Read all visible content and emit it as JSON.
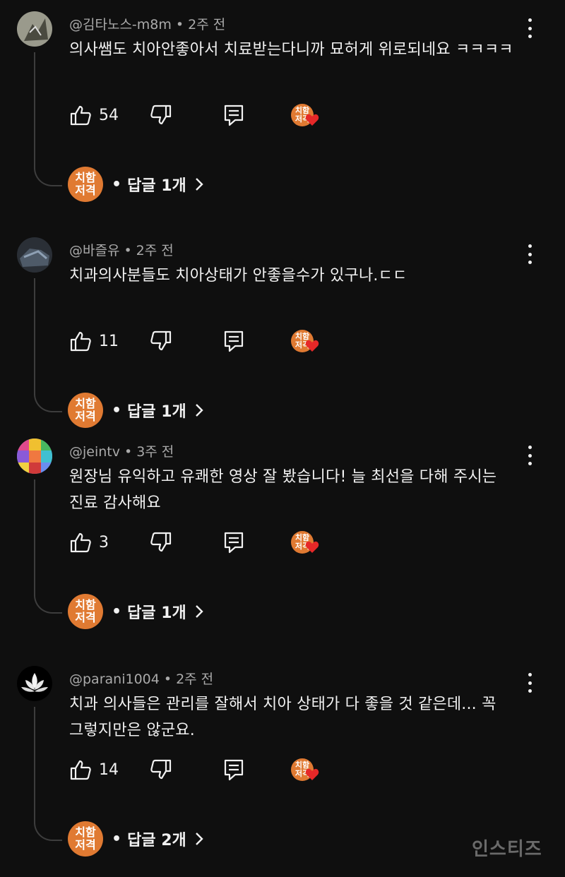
{
  "icons": {
    "like": "thumbs-up-icon",
    "dislike": "thumbs-down-icon",
    "reply": "comment-reply-icon",
    "more": "more-vert-icon",
    "chevron": "chevron-right-icon",
    "heart": "creator-heart-icon"
  },
  "colors": {
    "background": "#0f0f0f",
    "channel_logo": "#e07a32",
    "heart": "#e62828",
    "meta_text": "#aaaaaa"
  },
  "channel_logo": {
    "line1": "치함",
    "line2": "저격"
  },
  "comments": [
    {
      "author": "@김타노스-m8m",
      "time": "2주 전",
      "text": "의사쌤도 치아안좋아서 치료받는다니까 묘허게 위로되네요 ㅋㅋㅋㅋ",
      "likes": "54",
      "replies_label": "답글 1개"
    },
    {
      "author": "@바즐유",
      "time": "2주 전",
      "text": "치과의사분들도 치아상태가 안좋을수가 있구나.ㄷㄷ",
      "likes": "11",
      "replies_label": "답글 1개"
    },
    {
      "author": "@jeintv",
      "time": "3주 전",
      "text": "원장님 유익하고 유쾌한 영상 잘 봤습니다! 늘 최선을 다해 주시는 진료 감사해요",
      "likes": "3",
      "replies_label": "답글 1개"
    },
    {
      "author": "@parani1004",
      "time": "2주 전",
      "text": "치과 의사들은 관리를 잘해서 치아 상태가 다 좋을 것 같은데... 꼭 그렇지만은 않군요.",
      "likes": "14",
      "replies_label": "답글 2개"
    }
  ],
  "watermark": "인스티즈"
}
